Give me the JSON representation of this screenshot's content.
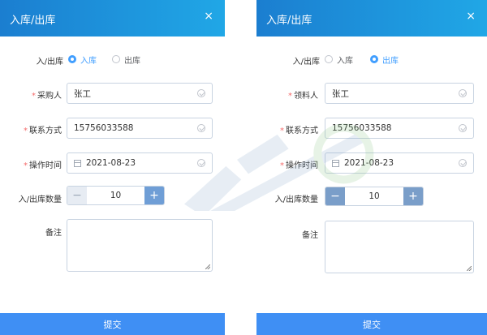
{
  "left": {
    "title": "入库/出库",
    "close": "×",
    "type_label": "入/出库",
    "radio_in": "入库",
    "radio_out": "出库",
    "selected": "in",
    "person_label": "采购人",
    "person_value": "张工",
    "contact_label": "联系方式",
    "contact_value": "15756033588",
    "time_label": "操作时间",
    "time_value": "2021-08-23",
    "qty_label": "入/出库数量",
    "qty_value": "10",
    "minus": "−",
    "plus": "+",
    "remark_label": "备注",
    "submit": "提交"
  },
  "right": {
    "title": "入库/出库",
    "close": "×",
    "type_label": "入/出库",
    "radio_in": "入库",
    "radio_out": "出库",
    "selected": "out",
    "person_label": "领料人",
    "person_value": "张工",
    "contact_label": "联系方式",
    "contact_value": "15756033588",
    "time_label": "操作时间",
    "time_value": "2021-08-23",
    "qty_label": "入/出库数量",
    "qty_value": "10",
    "minus": "−",
    "plus": "+",
    "remark_label": "备注",
    "submit": "提交"
  },
  "colors": {
    "header_start": "#1b7ed0",
    "header_end": "#20a7e6",
    "accent": "#409eff",
    "required": "#f56c6c",
    "submit": "#3f8ff4"
  },
  "icons": {
    "close": "close-icon",
    "check": "check-circle-icon",
    "calendar": "calendar-icon"
  }
}
